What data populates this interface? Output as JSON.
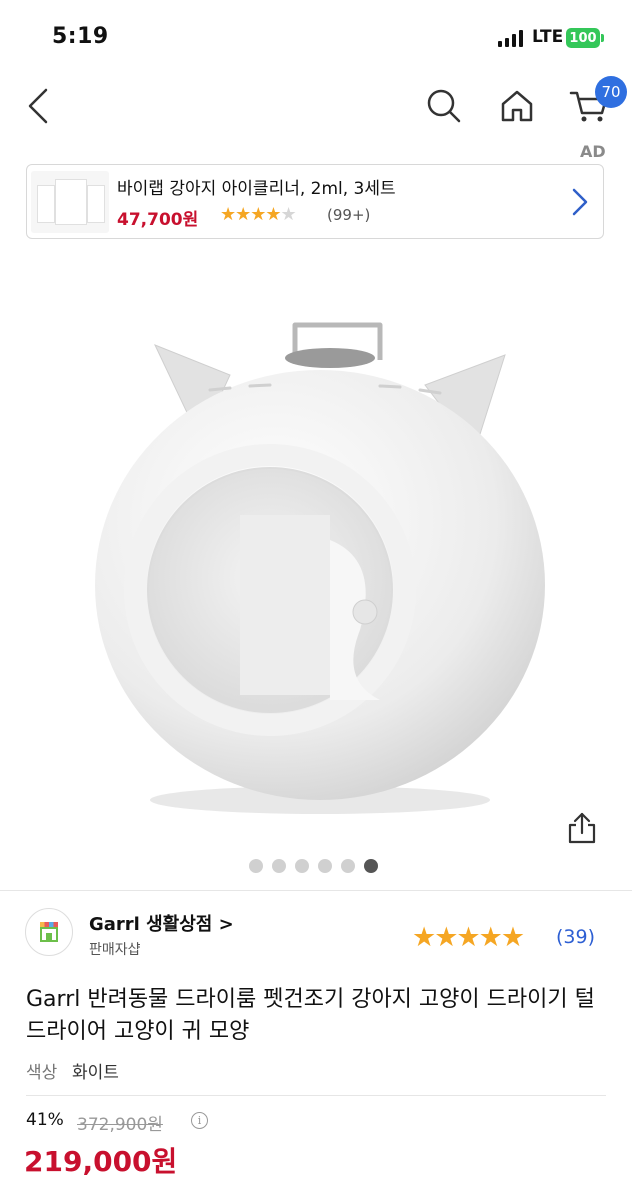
{
  "status": {
    "time": "5:19",
    "network": "LTE",
    "battery": "100"
  },
  "nav": {
    "cart_count": "70"
  },
  "ad": {
    "label": "AD",
    "title": "바이랩 강아지 아이클리너, 2ml, 3세트",
    "price": "47,700원",
    "rating": "4/5",
    "reviews": "(99+)"
  },
  "gallery": {
    "total": 6,
    "active_index": 5
  },
  "seller": {
    "name": "Garrl 생활상점 >",
    "sub": "판매자샵",
    "rating": "5/5",
    "reviews": "(39)"
  },
  "product": {
    "title": "Garrl 반려동물 드라이룸 펫건조기 강아지 고양이 드라이기 털 드라이어 고양이 귀 모양",
    "option_label": "색상",
    "option_value": "화이트",
    "discount": "41%",
    "original_price": "372,900원",
    "price": "219,000원"
  },
  "colors": {
    "accent_blue": "#2f6fe0",
    "price_red": "#c8102e",
    "star": "#f5a623",
    "battery": "#34c759"
  }
}
